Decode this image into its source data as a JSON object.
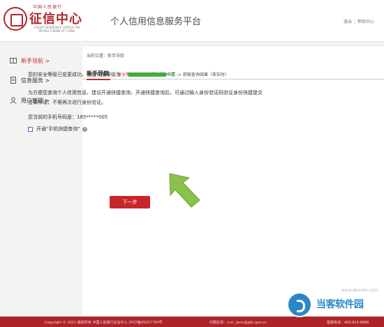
{
  "header": {
    "logo_small": "中国人民银行",
    "logo_main": "征信中心",
    "logo_en": "CREDIT REFERENCE CENTER THE PEOPLE'S BANK OF CHINA",
    "platform_title": "个人信用信息服务平台",
    "logout_label": "退出",
    "help_label": "帮助中心",
    "sep": "|"
  },
  "sidebar": {
    "items": [
      {
        "label": "新手导航 >",
        "icon": "book-icon",
        "active": true
      },
      {
        "label": "信息服务 >",
        "icon": "document-icon",
        "active": false
      },
      {
        "label": "用户管理 >",
        "icon": "user-icon",
        "active": false
      }
    ]
  },
  "main": {
    "breadcrumb": "当前位置：新手导航",
    "section_title": "新手导航",
    "steps": {
      "current": "安全等级变更",
      "rest": " -> 提交查询申请 -> 获取查询结果（非实时）"
    },
    "security_message": "您的安全等级已变更成功，当前安全等级为",
    "security_level": "高",
    "info_paragraph": "为方便您查询个人信用信息，建议开通快捷查询，开通快捷查询后，可通过输入身份验证码验证身份快捷提交查询申请，不需再次进行身份验证。",
    "phone_label": "您当前的手机号码是：",
    "phone_value": "185*****005",
    "quick_query_label": "开通\"手机快捷查询\"",
    "info_icon_glyph": "i",
    "next_button": "下一步"
  },
  "footer": {
    "copyright": "Copyright © 2011    版权所有    中国人民银行征信中心    沪ICP备05017794号",
    "feedback": "问题反馈：ccrc_ipcrs@pbc.gov.cn",
    "hotline": "客服电话：400-810-8866"
  },
  "watermark": {
    "text": "当客软件园",
    "url": "www.downkr.com"
  },
  "colors": {
    "brand_red": "#c8262a",
    "footer_red": "#ad2327",
    "level_green": "#3fae3a",
    "arrow_green": "#8bc34a"
  }
}
